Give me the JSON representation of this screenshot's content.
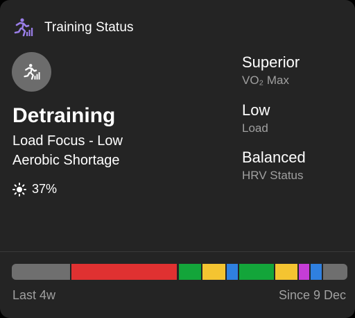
{
  "header": {
    "title": "Training Status",
    "icon": "runner-status-icon",
    "icon_color": "#9a7ee8"
  },
  "status": {
    "icon": "runner-status-icon",
    "name": "Detraining",
    "focus": "Load Focus - Low",
    "shortage": "Aerobic Shortage",
    "acclimation_icon": "sun-icon",
    "acclimation": "37%"
  },
  "metrics": [
    {
      "value": "Superior",
      "label": "VO₂ Max"
    },
    {
      "value": "Low",
      "label": "Load"
    },
    {
      "value": "Balanced",
      "label": "HRV Status"
    }
  ],
  "history_bar": {
    "colors": {
      "gray": "#6f6f6f",
      "red": "#e03131",
      "green": "#13a53a",
      "yellow": "#f4c431",
      "blue": "#2f80e0",
      "magenta": "#c53dd6"
    },
    "segments": [
      "gray",
      "red",
      "green",
      "yellow",
      "blue",
      "green",
      "yellow",
      "magenta",
      "blue",
      "gray"
    ]
  },
  "footer": {
    "left": "Last 4w",
    "right": "Since 9 Dec"
  }
}
